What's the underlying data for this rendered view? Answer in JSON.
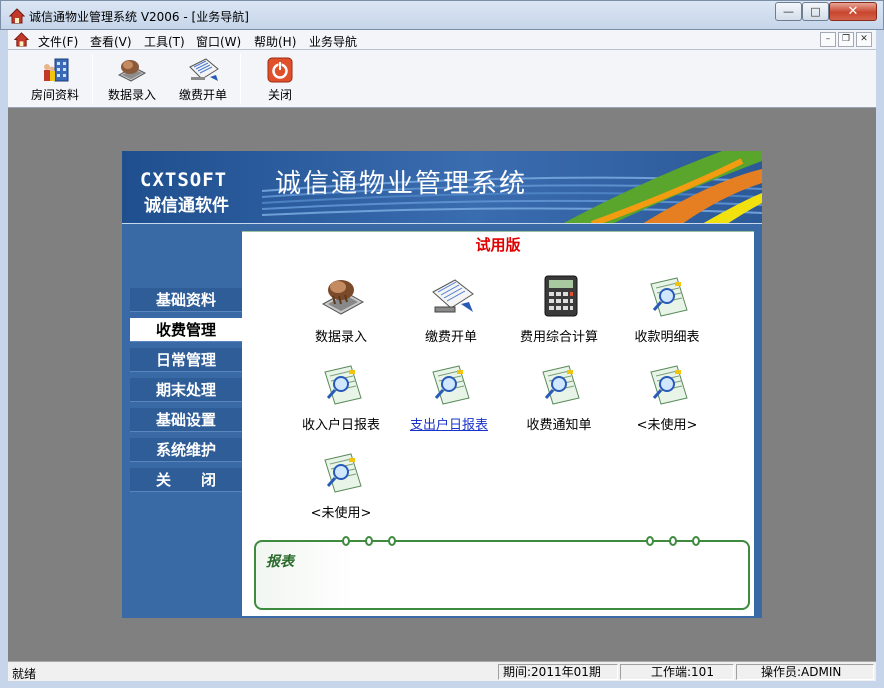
{
  "window": {
    "title": "诚信通物业管理系统 V2006 - [业务导航]",
    "min_glyph": "—",
    "max_glyph": "□",
    "close_glyph": "✕"
  },
  "menu": {
    "items": [
      "文件(F)",
      "查看(V)",
      "工具(T)",
      "窗口(W)",
      "帮助(H)",
      "业务导航"
    ],
    "mdi_min": "–",
    "mdi_restore": "❐",
    "mdi_close": "✕"
  },
  "toolbar": {
    "buttons": [
      {
        "label": "房间资料",
        "icon": "building-people-icon"
      },
      {
        "label": "数据录入",
        "icon": "keyboard-hand-icon"
      },
      {
        "label": "缴费开单",
        "icon": "invoice-pen-icon"
      },
      {
        "label": "关闭",
        "icon": "power-icon"
      }
    ]
  },
  "banner": {
    "brand_en": "CXTSOFT",
    "brand_cn": "诚信通软件",
    "title": "诚信通物业管理系统"
  },
  "nav": {
    "items": [
      "基础资料",
      "收费管理",
      "日常管理",
      "期末处理",
      "基础设置",
      "系统维护",
      "关　　闭"
    ],
    "active_index": 1
  },
  "content": {
    "badge": "试用版",
    "tiles": [
      {
        "label": "数据录入",
        "icon": "keyboard-hand-icon"
      },
      {
        "label": "缴费开单",
        "icon": "invoice-pen-icon"
      },
      {
        "label": "费用综合计算",
        "icon": "calculator-icon"
      },
      {
        "label": "收款明细表",
        "icon": "report-magnifier-icon"
      },
      {
        "label": "收入户日报表",
        "icon": "report-magnifier-icon"
      },
      {
        "label": "支出户日报表",
        "icon": "report-magnifier-icon"
      },
      {
        "label": "收费通知单",
        "icon": "report-magnifier-icon"
      },
      {
        "label": "<未使用>",
        "icon": "report-magnifier-icon"
      },
      {
        "label": "<未使用>",
        "icon": "report-magnifier-icon"
      }
    ],
    "report_title": "报表"
  },
  "status": {
    "ready": "就绪",
    "period": "期间:2011年01期",
    "workstation": "工作端:101",
    "operator": "操作员:ADMIN"
  },
  "colors": {
    "nav_bg": "#3a6aa5",
    "badge": "#e00000",
    "report_border": "#3e8a3e",
    "link": "#1a33cc"
  }
}
